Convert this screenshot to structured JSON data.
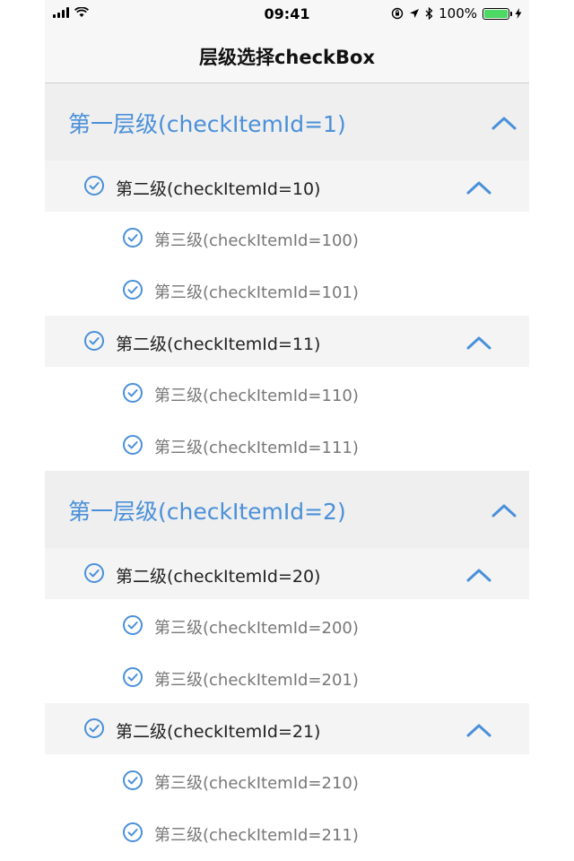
{
  "status_bar": {
    "time": "09:41",
    "battery": "100%",
    "icons": [
      "signal-icon",
      "wifi-icon",
      "lock-rotation-icon",
      "location-icon",
      "bluetooth-icon",
      "battery-icon",
      "charging-icon"
    ]
  },
  "nav": {
    "title": "层级选择checkBox"
  },
  "colors": {
    "accent": "#4a90d9",
    "battery": "#4cd964"
  },
  "groups": [
    {
      "label": "第一层级(checkItemId=1)",
      "children": [
        {
          "label": "第二级(checkItemId=10)",
          "items": [
            "第三级(checkItemId=100)",
            "第三级(checkItemId=101)"
          ]
        },
        {
          "label": "第二级(checkItemId=11)",
          "items": [
            "第三级(checkItemId=110)",
            "第三级(checkItemId=111)"
          ]
        }
      ]
    },
    {
      "label": "第一层级(checkItemId=2)",
      "children": [
        {
          "label": "第二级(checkItemId=20)",
          "items": [
            "第三级(checkItemId=200)",
            "第三级(checkItemId=201)"
          ]
        },
        {
          "label": "第二级(checkItemId=21)",
          "items": [
            "第三级(checkItemId=210)",
            "第三级(checkItemId=211)"
          ]
        }
      ]
    }
  ]
}
